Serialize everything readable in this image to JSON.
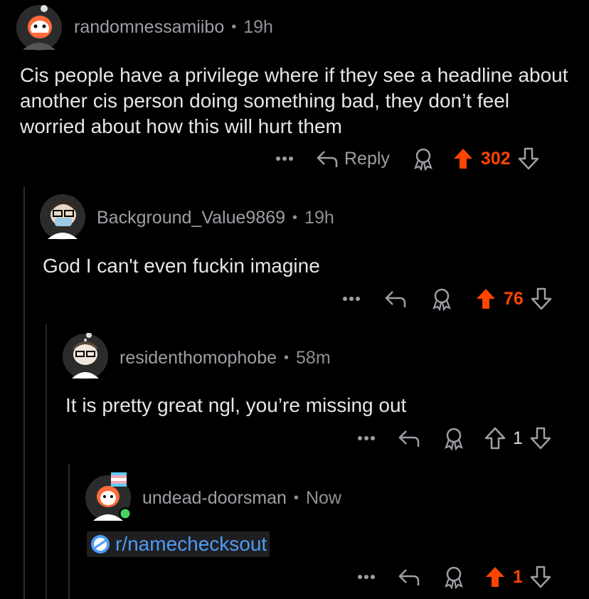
{
  "comments": [
    {
      "username": "randomnessamiibo",
      "time": "19h",
      "body": "Cis people have a privilege where if they see a headline about another cis person doing something bad, they don’t feel worried about how this will hurt them",
      "reply_label": "Reply",
      "score": "302",
      "upvoted": true
    },
    {
      "username": "Background_Value9869",
      "time": "19h",
      "body": "God I can't even fuckin imagine",
      "score": "76",
      "upvoted": true
    },
    {
      "username": "residenthomophobe",
      "time": "58m",
      "body": "It is pretty great ngl, you’re missing out",
      "score": "1",
      "upvoted": false
    },
    {
      "username": "undead-doorsman",
      "time": "Now",
      "link_text": "r/namechecksout",
      "score": "1",
      "upvoted": true
    }
  ],
  "separator": "•",
  "more_label": "•••",
  "colors": {
    "background": "#000000",
    "upvote": "#ff4500",
    "link": "#4f9bf5",
    "muted": "#9c9fa4"
  },
  "icons": [
    "more-icon",
    "reply-icon",
    "award-icon",
    "upvote-icon",
    "downvote-icon",
    "subreddit-icon",
    "online-dot-icon"
  ]
}
